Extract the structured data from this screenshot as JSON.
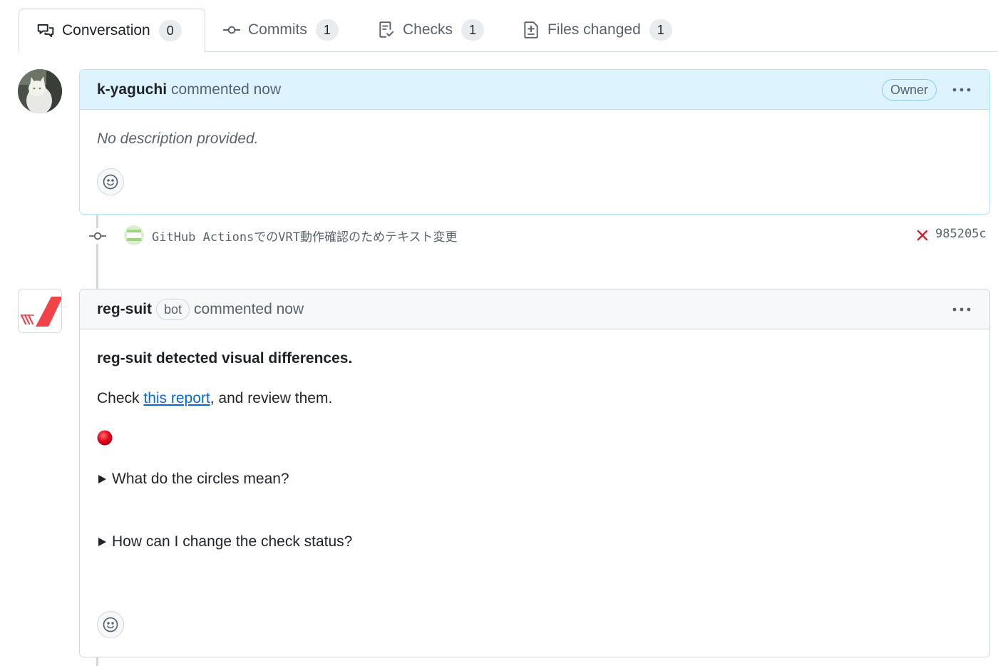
{
  "tabs": [
    {
      "label": "Conversation",
      "count": "0",
      "icon": "comment-discussion-icon",
      "active": true
    },
    {
      "label": "Commits",
      "count": "1",
      "icon": "git-commit-icon",
      "active": false
    },
    {
      "label": "Checks",
      "count": "1",
      "icon": "checklist-icon",
      "active": false
    },
    {
      "label": "Files changed",
      "count": "1",
      "icon": "file-diff-icon",
      "active": false
    }
  ],
  "first_comment": {
    "author": "k-yaguchi",
    "meta": "commented now",
    "role_label": "Owner",
    "body": "No description provided."
  },
  "commit": {
    "message": "GitHub ActionsでのVRT動作確認のためテキスト変更",
    "sha": "985205c",
    "status": "failure",
    "status_color": "#cf222e"
  },
  "bot_comment": {
    "author": "reg-suit",
    "bot_label": "bot",
    "meta": "commented now",
    "heading": "reg-suit detected visual differences.",
    "check_prefix": "Check ",
    "link_text": "this report",
    "check_suffix": ", and review them.",
    "status_dot": "red-circle",
    "details": [
      {
        "summary": "What do the circles mean?"
      },
      {
        "summary": "How can I change the check status?"
      }
    ]
  },
  "colors": {
    "link": "#0969da",
    "owner_header": "#ddf4ff",
    "red_dot": "#e0001b"
  }
}
